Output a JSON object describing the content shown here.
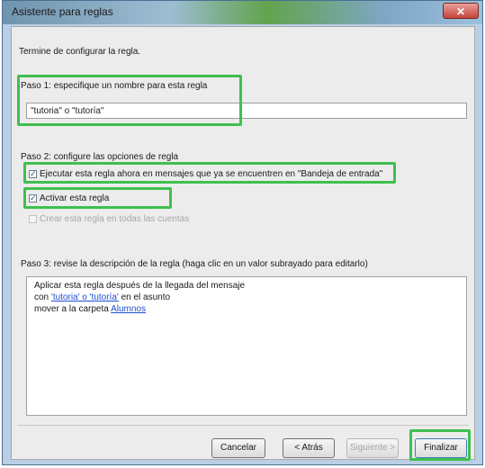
{
  "window": {
    "title": "Asistente para reglas",
    "close_glyph": "✕"
  },
  "header": {
    "subtitle": "Termine de configurar la regla."
  },
  "step1": {
    "label": "Paso 1: especifique un nombre para esta regla",
    "name_value": "\"tutoria\" o \"tutoría\""
  },
  "step2": {
    "label": "Paso 2: configure las opciones de regla",
    "options": [
      {
        "label": "Ejecutar esta regla ahora en mensajes que ya se encuentren en \"Bandeja de entrada\"",
        "checked": true,
        "enabled": true
      },
      {
        "label": "Activar esta regla",
        "checked": true,
        "enabled": true
      },
      {
        "label": "Crear esta regla en todas las cuentas",
        "checked": false,
        "enabled": false
      }
    ]
  },
  "step3": {
    "label": "Paso 3: revise la descripción de la regla (haga clic en un valor subrayado para editarlo)",
    "line1": "Aplicar esta regla después de la llegada del mensaje",
    "line2_prefix": "con",
    "line2_link": "'tutoria' o 'tutoría'",
    "line2_suffix": "en el asunto",
    "line3_prefix": "mover a la carpeta",
    "line3_link": "Alumnos"
  },
  "buttons": {
    "cancel": "Cancelar",
    "back": "< Atrás",
    "next": "Siguiente >",
    "finish": "Finalizar"
  },
  "checkmark": "✓"
}
